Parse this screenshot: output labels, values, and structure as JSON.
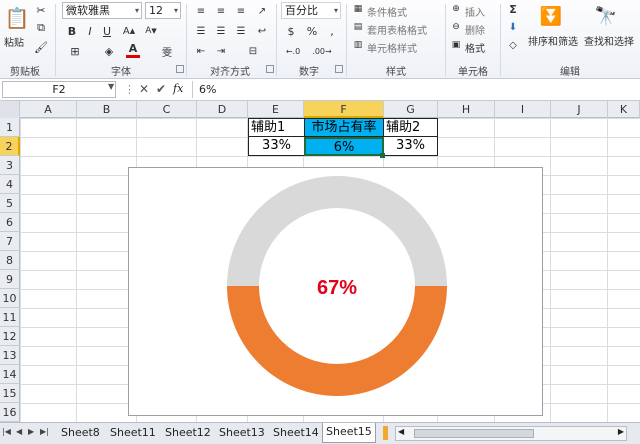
{
  "ribbon": {
    "clipboard": {
      "paste_label": "粘贴",
      "group_label": "剪贴板"
    },
    "font": {
      "font_name": "微软雅黑",
      "font_size": "12",
      "bold": "B",
      "italic": "I",
      "underline": "U",
      "group_label": "字体",
      "wen_glyph": "雯"
    },
    "alignment": {
      "group_label": "对齐方式"
    },
    "number": {
      "format": "百分比",
      "percent": "%",
      "comma": ",",
      "group_label": "数字"
    },
    "styles": {
      "conditional": "条件格式",
      "table_format": "套用表格格式",
      "cell_styles": "单元格样式",
      "group_label": "样式"
    },
    "cells": {
      "insert": "插入",
      "delete": "删除",
      "format": "格式",
      "group_label": "单元格"
    },
    "editing": {
      "sum": "Σ",
      "sort_filter": "排序和筛选",
      "find_select": "查找和选择",
      "group_label": "编辑"
    }
  },
  "formula_bar": {
    "name_box": "F2",
    "fx": "fx",
    "content": "6%"
  },
  "columns": [
    "A",
    "B",
    "C",
    "D",
    "E",
    "F",
    "G",
    "H",
    "I",
    "J",
    "K"
  ],
  "rows": [
    "1",
    "2",
    "3",
    "4",
    "5",
    "6",
    "7",
    "8",
    "9",
    "10",
    "11",
    "12",
    "13",
    "14",
    "15",
    "16"
  ],
  "cells": {
    "E1": "辅助1",
    "F1": "市场占有率",
    "G1": "辅助2",
    "E2": "33%",
    "F2": "6%",
    "G2": "33%"
  },
  "chart": {
    "center_label": "67%",
    "colors": {
      "gray": "#d9d9d9",
      "orange": "#ed7d31",
      "label": "#e3001b"
    }
  },
  "chart_data": {
    "type": "pie",
    "style": "doughnut",
    "categories": [
      "辅助1",
      "市场占有率",
      "辅助2"
    ],
    "values": [
      33,
      6,
      33
    ],
    "visible_label": "67%"
  },
  "sheets": [
    "Sheet8",
    "Sheet11",
    "Sheet12",
    "Sheet13",
    "Sheet14",
    "Sheet15"
  ],
  "active_sheet": "Sheet15"
}
